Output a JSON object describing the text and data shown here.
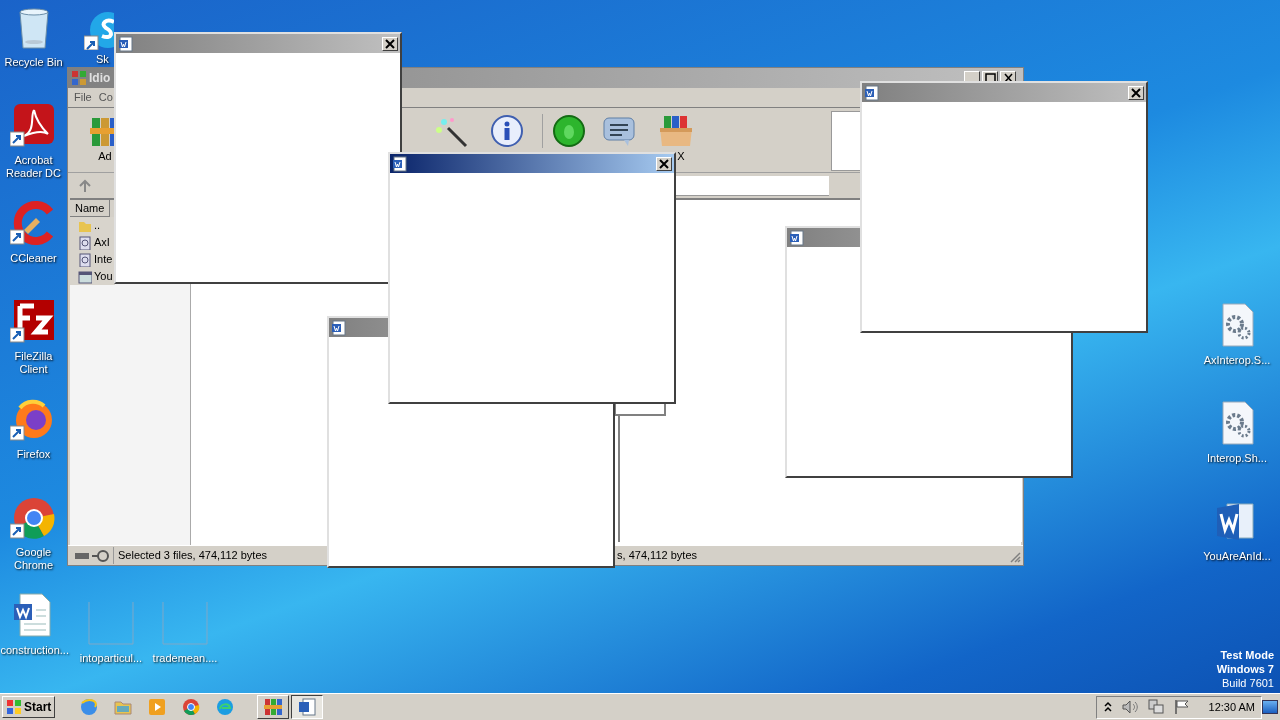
{
  "desktop": {
    "left_icons": [
      {
        "label": "Recycle Bin",
        "kind": "recycle",
        "shortcut": false
      },
      {
        "label": "Acrobat Reader DC",
        "kind": "acrobat",
        "shortcut": true
      },
      {
        "label": "CCleaner",
        "kind": "ccleaner",
        "shortcut": true
      },
      {
        "label": "FileZilla Client",
        "kind": "filezilla",
        "shortcut": true
      },
      {
        "label": "Firefox",
        "kind": "firefox",
        "shortcut": true
      },
      {
        "label": "Google Chrome",
        "kind": "chrome",
        "shortcut": true
      },
      {
        "label": "construction...",
        "kind": "word-doc",
        "shortcut": false
      }
    ],
    "top_icons": [
      {
        "label": "Sk",
        "kind": "skype",
        "shortcut": true
      }
    ],
    "bottom_icons": [
      {
        "label": "intoparticul...",
        "kind": "blank",
        "shortcut": false
      },
      {
        "label": "trademean....",
        "kind": "blank",
        "shortcut": false
      }
    ],
    "right_icons": [
      {
        "label": "AxInterop.S...",
        "kind": "gear-doc",
        "shortcut": false
      },
      {
        "label": "Interop.Sh...",
        "kind": "gear-doc",
        "shortcut": false
      },
      {
        "label": "YouAreAnId...",
        "kind": "word",
        "shortcut": false
      }
    ],
    "system_notice": [
      "Test Mode",
      "Windows 7",
      "Build 7601"
    ]
  },
  "archiver": {
    "title": "Idio",
    "menu": [
      "File",
      "Co"
    ],
    "toolbar": [
      {
        "kind": "add",
        "label": "Ad"
      },
      {
        "kind": "wizard"
      },
      {
        "kind": "info"
      },
      {
        "kind": "virus"
      },
      {
        "kind": "comment"
      },
      {
        "kind": "sfx",
        "label": "X"
      }
    ],
    "columns": [
      "Name"
    ],
    "rows": [
      {
        "name": "..",
        "kind": "folder"
      },
      {
        "name": "AxI",
        "kind": "dll"
      },
      {
        "name": "Inte",
        "kind": "dll"
      },
      {
        "name": "You",
        "kind": "doc"
      }
    ],
    "status": [
      "Selected 3 files, 474,112 bytes",
      "s, 474,112 bytes"
    ]
  },
  "popups": [
    {
      "active": false
    },
    {
      "active": false
    },
    {
      "active": false
    },
    {
      "active": false
    },
    {
      "active": true
    }
  ],
  "taskbar": {
    "start": "Start",
    "apps": [
      {
        "kind": "ie",
        "running": false,
        "active": false
      },
      {
        "kind": "explorer",
        "running": false,
        "active": false
      },
      {
        "kind": "media",
        "running": false,
        "active": false
      },
      {
        "kind": "chrome",
        "running": false,
        "active": false
      },
      {
        "kind": "edge",
        "running": false,
        "active": false
      },
      {
        "kind": "winrar",
        "running": true,
        "active": false
      },
      {
        "kind": "word",
        "running": true,
        "active": true
      }
    ],
    "clock": "12:30 AM"
  }
}
